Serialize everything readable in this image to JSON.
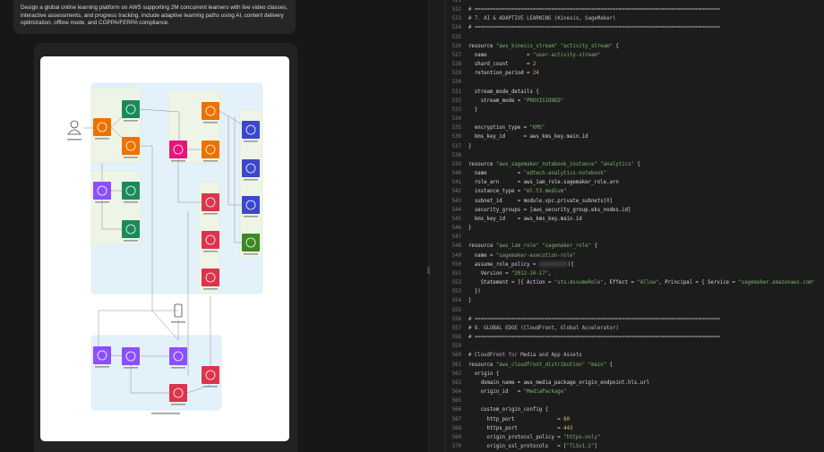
{
  "prompt": {
    "text": "Design a global online learning platform on AWS supporting 2M concurrent learners with live video classes, interactive assessments, and progress tracking. Include adaptive learning paths using AI, content delivery optimization, offline mode, and COPPA/FERPA compliance."
  },
  "diagram": {
    "colors": {
      "region_fill": "#e3f1fb",
      "subregion_fill": "#eef5e6",
      "edge": "#8a8a8a",
      "orange": "#ed7100",
      "green": "#1b8a5a",
      "pink": "#e7157b",
      "blue": "#3b48cc",
      "s3_green": "#3f8624",
      "purple": "#8c4fff",
      "red": "#dd344c"
    },
    "icons": [
      {
        "name": "user-icon",
        "color": "person"
      },
      {
        "name": "media-services-icon",
        "color": "orange"
      },
      {
        "name": "chime-icon",
        "color": "green"
      },
      {
        "name": "media-package-icon",
        "color": "orange"
      },
      {
        "name": "elemental-icon",
        "color": "orange"
      },
      {
        "name": "api-gateway-icon",
        "color": "pink"
      },
      {
        "name": "lambda-icon",
        "color": "orange"
      },
      {
        "name": "dynamodb-accelerator-icon",
        "color": "blue"
      },
      {
        "name": "dynamodb-icon",
        "color": "blue"
      },
      {
        "name": "aurora-icon",
        "color": "blue"
      },
      {
        "name": "s3-bucket-icon",
        "color": "s3_green"
      },
      {
        "name": "kinesis-icon",
        "color": "purple"
      },
      {
        "name": "personalize-icon",
        "color": "green"
      },
      {
        "name": "sagemaker-icon",
        "color": "green"
      },
      {
        "name": "cognito-icon",
        "color": "red"
      },
      {
        "name": "kms-icon",
        "color": "red"
      },
      {
        "name": "guardduty-icon",
        "color": "red"
      },
      {
        "name": "mobile-device-icon",
        "color": "device"
      },
      {
        "name": "route53-icon",
        "color": "purple"
      },
      {
        "name": "global-accelerator-icon",
        "color": "purple"
      },
      {
        "name": "cloudfront-icon",
        "color": "purple"
      },
      {
        "name": "waf-icon",
        "color": "red"
      },
      {
        "name": "shield-icon",
        "color": "red"
      }
    ]
  },
  "code": {
    "lines": [
      {
        "n": "521",
        "t": []
      },
      {
        "n": "522",
        "t": [
          [
            "# ================================================================================",
            "com"
          ]
        ]
      },
      {
        "n": "523",
        "t": [
          [
            "# ",
            "com"
          ],
          [
            "7.",
            "num"
          ],
          [
            " AI & ADAPTIVE LEARNING (Kinesis, SageMaker)",
            "com"
          ]
        ]
      },
      {
        "n": "524",
        "t": [
          [
            "# ================================================================================",
            "com"
          ]
        ]
      },
      {
        "n": "525",
        "t": []
      },
      {
        "n": "526",
        "t": [
          [
            "resource ",
            "plain"
          ],
          [
            "\"aws_kinesis_stream\"",
            "str"
          ],
          [
            " ",
            "plain"
          ],
          [
            "\"activity_stream\"",
            "str"
          ],
          [
            " {",
            "plain"
          ]
        ]
      },
      {
        "n": "527",
        "t": [
          [
            "  name             = ",
            "plain"
          ],
          [
            "\"user-activity-stream\"",
            "str"
          ]
        ]
      },
      {
        "n": "528",
        "t": [
          [
            "  shard_count      = ",
            "plain"
          ],
          [
            "2",
            "num"
          ]
        ]
      },
      {
        "n": "529",
        "t": [
          [
            "  retention_period = ",
            "plain"
          ],
          [
            "24",
            "num"
          ]
        ]
      },
      {
        "n": "530",
        "t": []
      },
      {
        "n": "531",
        "t": [
          [
            "  stream_mode_details {",
            "plain"
          ]
        ]
      },
      {
        "n": "532",
        "t": [
          [
            "    stream_mode = ",
            "plain"
          ],
          [
            "\"PROVISIONED\"",
            "str"
          ]
        ]
      },
      {
        "n": "533",
        "t": [
          [
            "  }",
            "plain"
          ]
        ]
      },
      {
        "n": "534",
        "t": []
      },
      {
        "n": "535",
        "t": [
          [
            "  encryption_type = ",
            "plain"
          ],
          [
            "\"KMS\"",
            "str"
          ]
        ]
      },
      {
        "n": "536",
        "t": [
          [
            "  kms_key_id      = aws_kms_key.main.id",
            "plain"
          ]
        ]
      },
      {
        "n": "537",
        "t": [
          [
            "}",
            "plain"
          ]
        ]
      },
      {
        "n": "538",
        "t": []
      },
      {
        "n": "539",
        "t": [
          [
            "resource ",
            "plain"
          ],
          [
            "\"aws_sagemaker_notebook_instance\"",
            "str"
          ],
          [
            " ",
            "plain"
          ],
          [
            "\"analytics\"",
            "str"
          ],
          [
            " {",
            "plain"
          ]
        ]
      },
      {
        "n": "540",
        "t": [
          [
            "  name          = ",
            "plain"
          ],
          [
            "\"edtech-analytics-notebook\"",
            "str"
          ]
        ]
      },
      {
        "n": "541",
        "t": [
          [
            "  role_arn      = aws_iam_role.sagemaker_role.arn",
            "plain"
          ]
        ]
      },
      {
        "n": "542",
        "t": [
          [
            "  instance_type = ",
            "plain"
          ],
          [
            "\"ml.t3.medium\"",
            "str"
          ]
        ]
      },
      {
        "n": "543",
        "t": [
          [
            "  subnet_id     = module.vpc.private_subnets[",
            "plain"
          ],
          [
            "0",
            "num"
          ],
          [
            "]",
            "plain"
          ]
        ]
      },
      {
        "n": "544",
        "t": [
          [
            "  security_groups = [aws_security_group.eks_nodes.id]",
            "plain"
          ]
        ]
      },
      {
        "n": "545",
        "t": [
          [
            "  kms_key_id    = aws_kms_key.main.id",
            "plain"
          ]
        ]
      },
      {
        "n": "546",
        "t": [
          [
            "}",
            "plain"
          ]
        ]
      },
      {
        "n": "547",
        "t": []
      },
      {
        "n": "548",
        "t": [
          [
            "resource ",
            "plain"
          ],
          [
            "\"aws_iam_role\"",
            "str"
          ],
          [
            " ",
            "plain"
          ],
          [
            "\"sagemaker_role\"",
            "str"
          ],
          [
            " {",
            "plain"
          ]
        ]
      },
      {
        "n": "549",
        "t": [
          [
            "  name = ",
            "plain"
          ],
          [
            "\"sagemaker-execution-role\"",
            "str"
          ]
        ]
      },
      {
        "n": "550",
        "t": [
          [
            "  assume_role_policy = ",
            "plain"
          ],
          [
            "",
            "redact"
          ],
          [
            "({",
            "plain"
          ]
        ]
      },
      {
        "n": "551",
        "t": [
          [
            "    Version = ",
            "plain"
          ],
          [
            "\"2012-10-17\"",
            "str"
          ],
          [
            ",",
            "plain"
          ]
        ]
      },
      {
        "n": "552",
        "t": [
          [
            "    Statement = [{ Action = ",
            "plain"
          ],
          [
            "\"sts:AssumeRole\"",
            "str"
          ],
          [
            ", Effect = ",
            "plain"
          ],
          [
            "\"Allow\"",
            "str"
          ],
          [
            ", Principal = { Service = ",
            "plain"
          ],
          [
            "\"sagemaker.amazonaws.com\"",
            "str"
          ]
        ]
      },
      {
        "n": "553",
        "t": [
          [
            "  })",
            "plain"
          ]
        ]
      },
      {
        "n": "554",
        "t": [
          [
            "}",
            "plain"
          ]
        ]
      },
      {
        "n": "555",
        "t": []
      },
      {
        "n": "556",
        "t": [
          [
            "# ================================================================================",
            "com"
          ]
        ]
      },
      {
        "n": "557",
        "t": [
          [
            "# ",
            "com"
          ],
          [
            "8.",
            "num"
          ],
          [
            " GLOBAL EDGE (CloudFront, Global Accelerator)",
            "com"
          ]
        ]
      },
      {
        "n": "558",
        "t": [
          [
            "# ================================================================================",
            "com"
          ]
        ]
      },
      {
        "n": "559",
        "t": []
      },
      {
        "n": "560",
        "t": [
          [
            "# CloudFront ",
            "com"
          ],
          [
            "for",
            "kw"
          ],
          [
            " Media and App Assets",
            "com"
          ]
        ]
      },
      {
        "n": "561",
        "t": [
          [
            "resource ",
            "plain"
          ],
          [
            "\"aws_cloudfront_distribution\"",
            "str"
          ],
          [
            " ",
            "plain"
          ],
          [
            "\"main\"",
            "str"
          ],
          [
            " {",
            "plain"
          ]
        ]
      },
      {
        "n": "562",
        "t": [
          [
            "  origin {",
            "plain"
          ]
        ]
      },
      {
        "n": "563",
        "t": [
          [
            "    domain_name = aws_media_package_origin_endpoint.hls.url",
            "plain"
          ]
        ]
      },
      {
        "n": "564",
        "t": [
          [
            "    origin_id   = ",
            "plain"
          ],
          [
            "\"MediaPackage\"",
            "str"
          ]
        ]
      },
      {
        "n": "565",
        "t": []
      },
      {
        "n": "566",
        "t": [
          [
            "    custom_origin_config {",
            "plain"
          ]
        ]
      },
      {
        "n": "567",
        "t": [
          [
            "      http_port              = ",
            "plain"
          ],
          [
            "80",
            "num"
          ]
        ]
      },
      {
        "n": "568",
        "t": [
          [
            "      https_port             = ",
            "plain"
          ],
          [
            "443",
            "num"
          ]
        ]
      },
      {
        "n": "569",
        "t": [
          [
            "      origin_protocol_policy = ",
            "plain"
          ],
          [
            "\"https-only\"",
            "str"
          ]
        ]
      },
      {
        "n": "570",
        "t": [
          [
            "      origin_ssl_protocols   = [",
            "plain"
          ],
          [
            "\"TLSv1.2\"",
            "str"
          ],
          [
            "]",
            "plain"
          ]
        ]
      }
    ]
  }
}
